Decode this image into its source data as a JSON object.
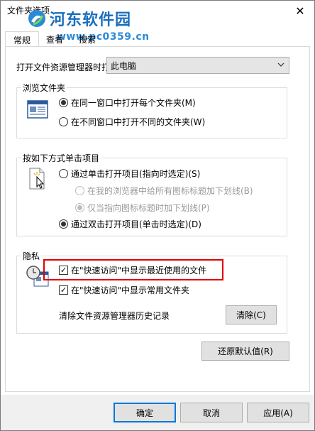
{
  "window": {
    "title": "文件夹选项",
    "close_glyph": "✕"
  },
  "watermark": {
    "title": "河东软件园",
    "url": "www.pc0359.cn"
  },
  "tabs": [
    {
      "label": "常规"
    },
    {
      "label": "查看"
    },
    {
      "label": "搜索"
    }
  ],
  "general": {
    "open_explorer_label": "打开文件资源管理器时打",
    "open_explorer_value": "此电脑",
    "browse_folders": {
      "title": "浏览文件夹",
      "options": [
        {
          "label": "在同一窗口中打开每个文件夹(M)",
          "checked": true
        },
        {
          "label": "在不同窗口中打开不同的文件夹(W)",
          "checked": false
        }
      ]
    },
    "click_items": {
      "title": "按如下方式单击项目",
      "single_click": "通过单击打开项目(指向时选定)(S)",
      "underline_always": "在我的浏览器中给所有图标标题加下划线(B)",
      "underline_point": "仅当指向图标标题时加下划线(P)",
      "double_click": "通过双击打开项目(单击时选定)(D)"
    },
    "privacy": {
      "title": "隐私",
      "recent_files": "在\"快速访问\"中显示最近使用的文件",
      "frequent_folders": "在\"快速访问\"中显示常用文件夹",
      "clear_history_label": "清除文件资源管理器历史记录",
      "clear_button": "清除(C)"
    },
    "restore_defaults": "还原默认值(R)"
  },
  "footer": {
    "ok": "确定",
    "cancel": "取消",
    "apply": "应用(A)"
  },
  "check_glyph": "✓",
  "select_arrow_glyph": "⌄"
}
